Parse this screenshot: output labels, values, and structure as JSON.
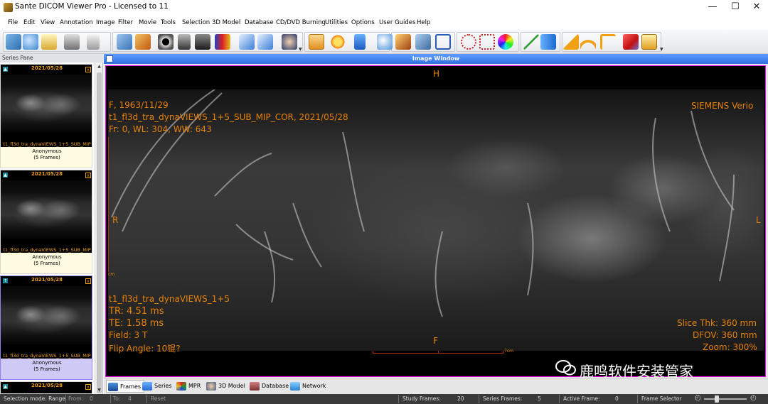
{
  "window": {
    "title": "Sante DICOM Viewer Pro - Licensed to 11",
    "controls": {
      "minimize": "—",
      "maximize": "☐",
      "close": "✕"
    }
  },
  "menu": [
    "File",
    "Edit",
    "View",
    "Annotation",
    "Image",
    "Filter",
    "Movie",
    "Tools",
    "Selection",
    "3D Model",
    "Database",
    "CD/DVD Burning",
    "Utilities",
    "Options",
    "User Guides",
    "Help"
  ],
  "toolbar": {
    "icons": [
      "open-icon",
      "search-icon",
      "export-icon",
      "print-icon",
      "copy-icon",
      "anonymize-icon",
      "tools-icon",
      "eye-icon",
      "stack-icon",
      "palette-icon",
      "fit-icon",
      "fullscreen-icon",
      "image-icon",
      "pan-icon",
      "brightness-icon",
      "scroll-icon",
      "zoom-icon",
      "magnify-icon",
      "zoom-fit-icon",
      "rect-roi-icon",
      "ellipse-roi-icon",
      "rect-select-icon",
      "color-icon",
      "line-icon",
      "arrow-icon",
      "angle-icon",
      "protractor-icon",
      "cobb-icon",
      "eraser-icon",
      "text-icon"
    ]
  },
  "series_pane": {
    "header": "Series Pane",
    "series": [
      {
        "date": "2021/05/28",
        "name": "t1_fl3d_tra_dynaVIEWS_1+5_SUB_MIP",
        "owner": "Anonymous",
        "frames": "(5 Frames)",
        "selected": false
      },
      {
        "date": "2021/05/28",
        "name": "t1_fl3d_tra_dynaVIEWS_1+5_SUB_MIP",
        "owner": "Anonymous",
        "frames": "(5 Frames)",
        "selected": false
      },
      {
        "date": "2021/05/28",
        "name": "t1_fl3d_tra_dynaVIEWS_1+5_SUB_MIP",
        "owner": "Anonymous",
        "frames": "(5 Frames)",
        "selected": true
      },
      {
        "date": "2021/05/28"
      }
    ]
  },
  "image_window": {
    "header": "Image Window",
    "overlay": {
      "orient_top": "H",
      "orient_bottom": "F",
      "orient_left": "R",
      "orient_right": "L",
      "patient": "F, 1963/11/29",
      "series": "t1_fl3d_tra_dynaVIEWS_1+5_SUB_MIP_COR,  2021/05/28",
      "frame": "Fr: 0, WL: 304, WW: 643",
      "scanner": "SIEMENS  Verio",
      "protocol": "t1_fl3d_tra_dynaVIEWS_1+5",
      "tr": "TR: 4.51 ms",
      "te": "TE: 1.58 ms",
      "field": "Field: 3 T",
      "flip": "Flip  Angle: 10锟?",
      "slice": "Slice Thk: 360 mm",
      "dfov": "DFOV: 360 mm",
      "zoom": "Zoom: 300%",
      "ruler_v_unit": "cm",
      "ruler_h_unit": "7cm"
    }
  },
  "tabs": [
    "Frames",
    "Series",
    "MPR",
    "3D Model",
    "Database",
    "Network"
  ],
  "status": {
    "mode": "Selection mode: Range",
    "from_label": "From:",
    "from_value": "0",
    "to_label": "To:",
    "to_value": "4",
    "reset": "Reset",
    "study_frames_label": "Study Frames:",
    "study_frames_value": "20",
    "series_frames_label": "Series Frames:",
    "series_frames_value": "5",
    "active_frame_label": "Active Frame:",
    "active_frame_value": "0",
    "frame_selector": "Frame Selector"
  },
  "watermark": "鹿鸣软件安装管家",
  "colors": {
    "overlay_text": "#e8820a",
    "accent_header": "#2f6fe0",
    "viewport_border": "#ff00ff"
  }
}
